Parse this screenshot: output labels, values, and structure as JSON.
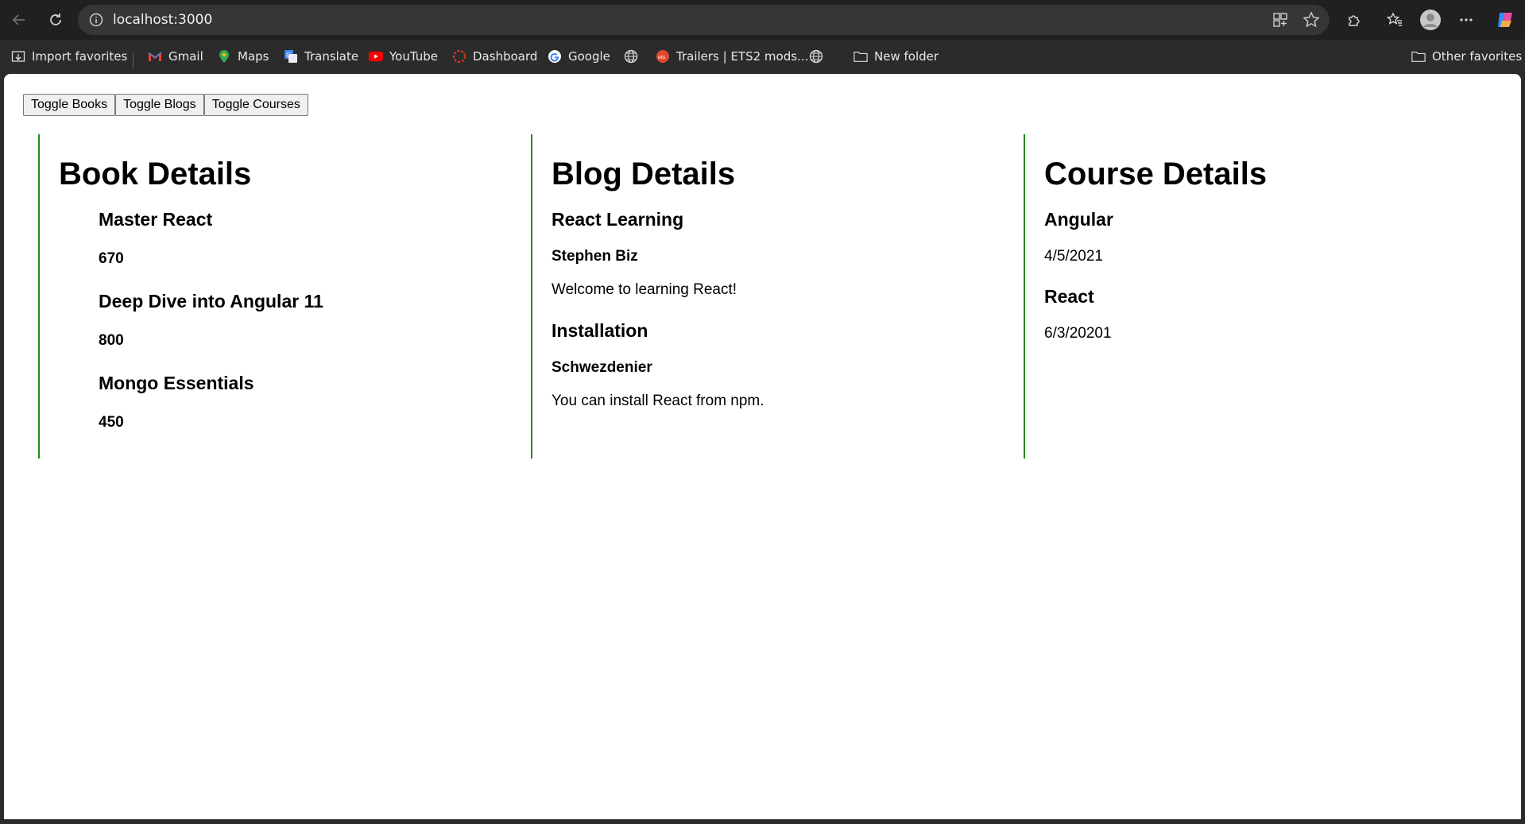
{
  "browser": {
    "url": "localhost:3000",
    "favorites": [
      {
        "label": "Import favorites",
        "icon": "import-favorites-icon"
      },
      {
        "label": "Gmail",
        "icon": "gmail-icon"
      },
      {
        "label": "Maps",
        "icon": "maps-icon"
      },
      {
        "label": "Translate",
        "icon": "translate-icon"
      },
      {
        "label": "YouTube",
        "icon": "youtube-icon"
      },
      {
        "label": "Dashboard",
        "icon": "dashboard-icon"
      },
      {
        "label": "Google",
        "icon": "google-icon"
      },
      {
        "label": "",
        "icon": "globe-icon"
      },
      {
        "label": "Trailers | ETS2 mods...",
        "icon": "trailers-site-icon"
      },
      {
        "label": "",
        "icon": "globe-icon"
      },
      {
        "label": "New folder",
        "icon": "folder-icon"
      }
    ],
    "other_favorites": "Other favorites"
  },
  "toolbar": {
    "toggle_books": "Toggle Books",
    "toggle_blogs": "Toggle Blogs",
    "toggle_courses": "Toggle Courses"
  },
  "books": {
    "heading": "Book Details",
    "items": [
      {
        "name": "Master React",
        "price": "670"
      },
      {
        "name": "Deep Dive into Angular 11",
        "price": "800"
      },
      {
        "name": "Mongo Essentials",
        "price": "450"
      }
    ]
  },
  "blogs": {
    "heading": "Blog Details",
    "items": [
      {
        "title": "React Learning",
        "author": "Stephen Biz",
        "content": "Welcome to learning React!"
      },
      {
        "title": "Installation",
        "author": "Schwezdenier",
        "content": "You can install React from npm."
      }
    ]
  },
  "courses": {
    "heading": "Course Details",
    "items": [
      {
        "name": "Angular",
        "date": "4/5/2021"
      },
      {
        "name": "React",
        "date": "6/3/20201"
      }
    ]
  },
  "colors": {
    "panel_border": "#1e8a1e",
    "chrome_bg": "#202020"
  }
}
